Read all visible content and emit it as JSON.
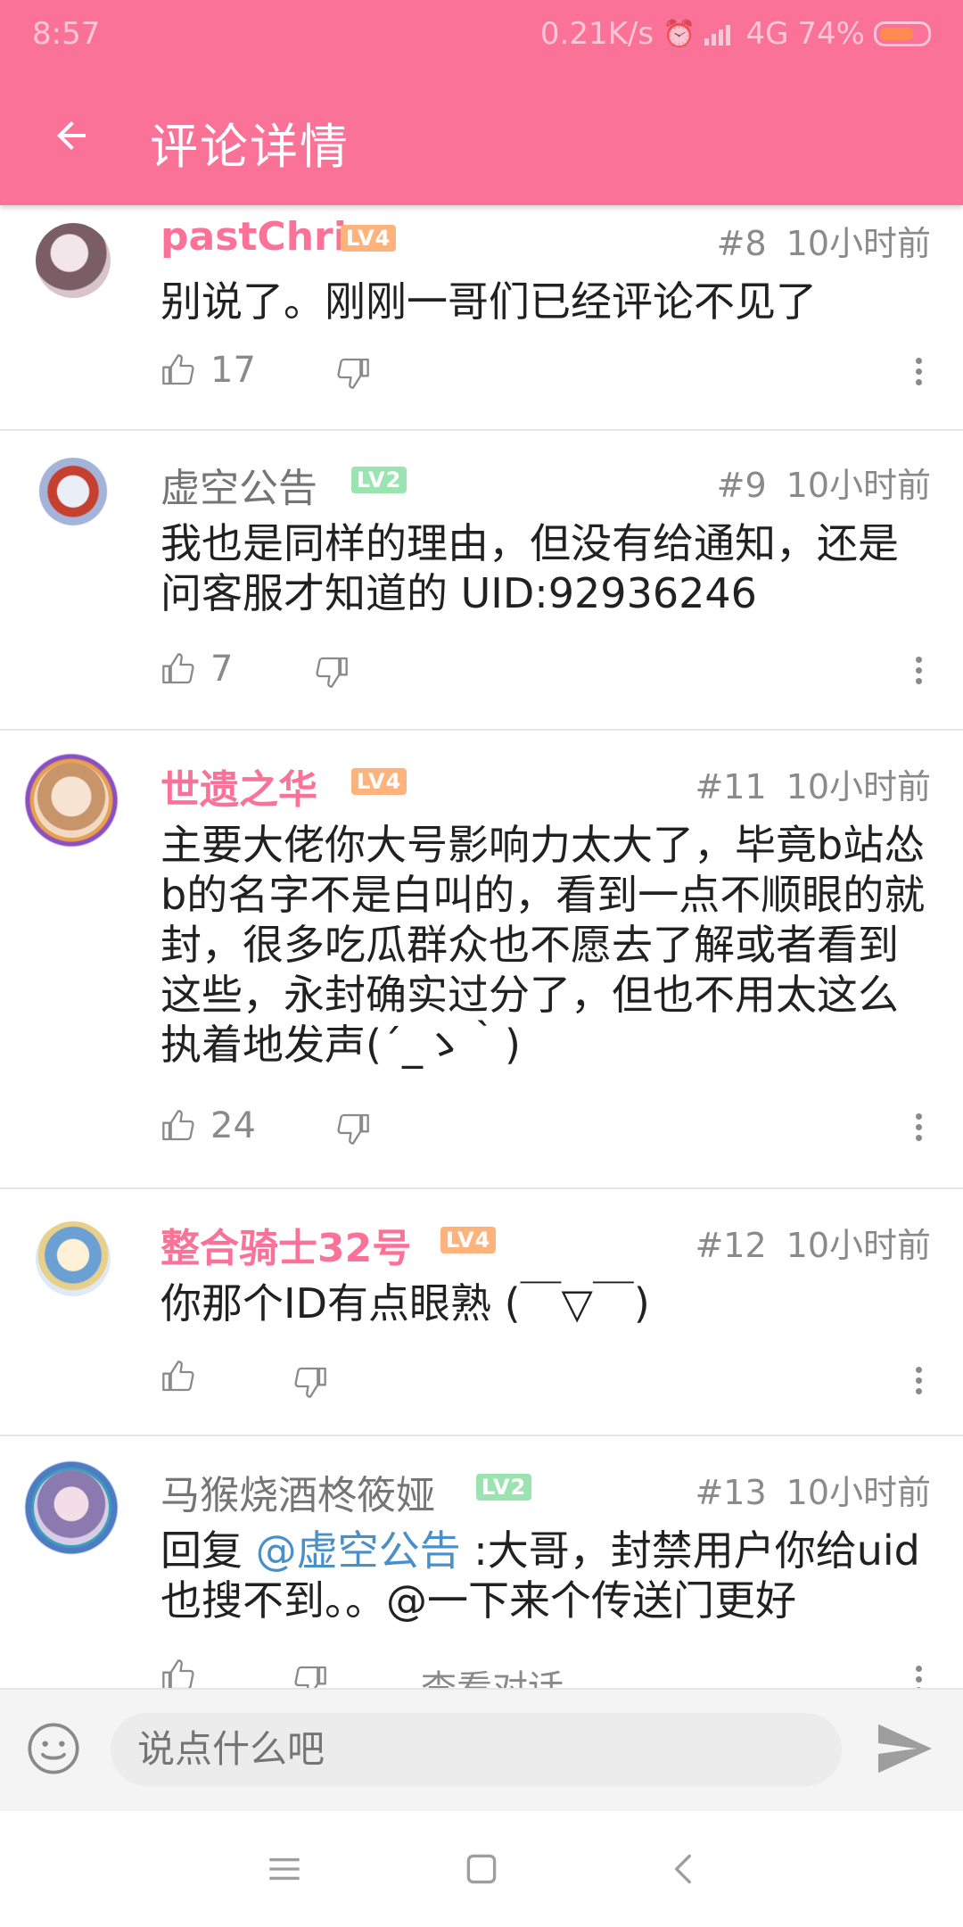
{
  "status": {
    "time": "8:57",
    "speed": "0.21K/s",
    "network": "4G",
    "battery": "74%",
    "battery_level": 0.74
  },
  "toolbar": {
    "title": "评论详情"
  },
  "comments": [
    {
      "user": "pastChri",
      "level": "LV4",
      "floor": "#8",
      "time": "10小时前",
      "text": "别说了。刚刚一哥们已经评论不见了",
      "likes": "17"
    },
    {
      "user": "虚空公告",
      "level": "LV2",
      "floor": "#9",
      "time": "10小时前",
      "text": "我也是同样的理由，但没有给通知，还是问客服才知道的 UID:92936246",
      "likes": "7"
    },
    {
      "user": "世遗之华",
      "level": "LV4",
      "floor": "#11",
      "time": "10小时前",
      "text": "主要大佬你大号影响力太大了，毕竟b站怂b的名字不是白叫的，看到一点不顺眼的就封，很多吃瓜群众也不愿去了解或者看到这些，永封确实过分了，但也不用太这么执着地发声(´_ゝ｀)",
      "likes": "24"
    },
    {
      "user": "整合骑士32号",
      "level": "LV4",
      "floor": "#12",
      "time": "10小时前",
      "text": "你那个ID有点眼熟 (￣▽￣)",
      "likes": ""
    },
    {
      "user": "马猴烧酒柊筱娅",
      "level": "LV2",
      "floor": "#13",
      "time": "10小时前",
      "reply_prefix": "回复 ",
      "mention": "@虚空公告",
      "text": " :大哥，封禁用户你给uid也搜不到。。@一下来个传送门更好",
      "likes": "",
      "extra": "查看对话"
    }
  ],
  "input": {
    "placeholder": "说点什么吧"
  },
  "colors": {
    "accent": "#fb7299",
    "lv4": "#ffb37c",
    "lv2": "#9be3b0",
    "mention": "#4a90c8"
  },
  "icons": [
    "back-arrow-icon",
    "thumb-up-icon",
    "thumb-down-icon",
    "more-vert-icon",
    "emoji-icon",
    "send-icon",
    "menu-icon",
    "home-square-icon",
    "back-chevron-icon"
  ]
}
